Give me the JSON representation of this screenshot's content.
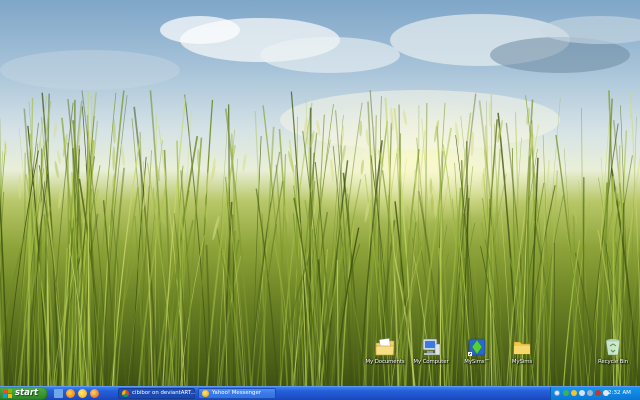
{
  "desktop": {
    "icons": [
      {
        "name": "my-documents",
        "label": "My Documents"
      },
      {
        "name": "my-computer",
        "label": "My Computer"
      },
      {
        "name": "mysims-tm",
        "label": "MySims™"
      },
      {
        "name": "mysims-folder",
        "label": "MySims"
      },
      {
        "name": "recycle-bin",
        "label": "Recycle Bin"
      }
    ]
  },
  "taskbar": {
    "start_label": "start",
    "quicklaunch": [
      "show-desktop-icon",
      "firefox-icon",
      "messenger-icon",
      "browser-icon"
    ],
    "tasks": [
      {
        "label": "cibibor on deviantART...",
        "icon": "chrome-icon",
        "active": true
      },
      {
        "label": "Yahoo! Messenger",
        "icon": "yahoo-messenger-icon",
        "active": false
      }
    ],
    "tray": {
      "icons": [
        "tray-expand-icon",
        "tray-app-icon",
        "tray-messenger-icon",
        "tray-network-icon",
        "tray-volume-icon",
        "tray-security-icon",
        "tray-update-icon"
      ],
      "clock": "2:32 AM"
    }
  },
  "colors": {
    "taskbar": "#2152cc",
    "start": "#3a9a34",
    "tray": "#0f86e3"
  }
}
